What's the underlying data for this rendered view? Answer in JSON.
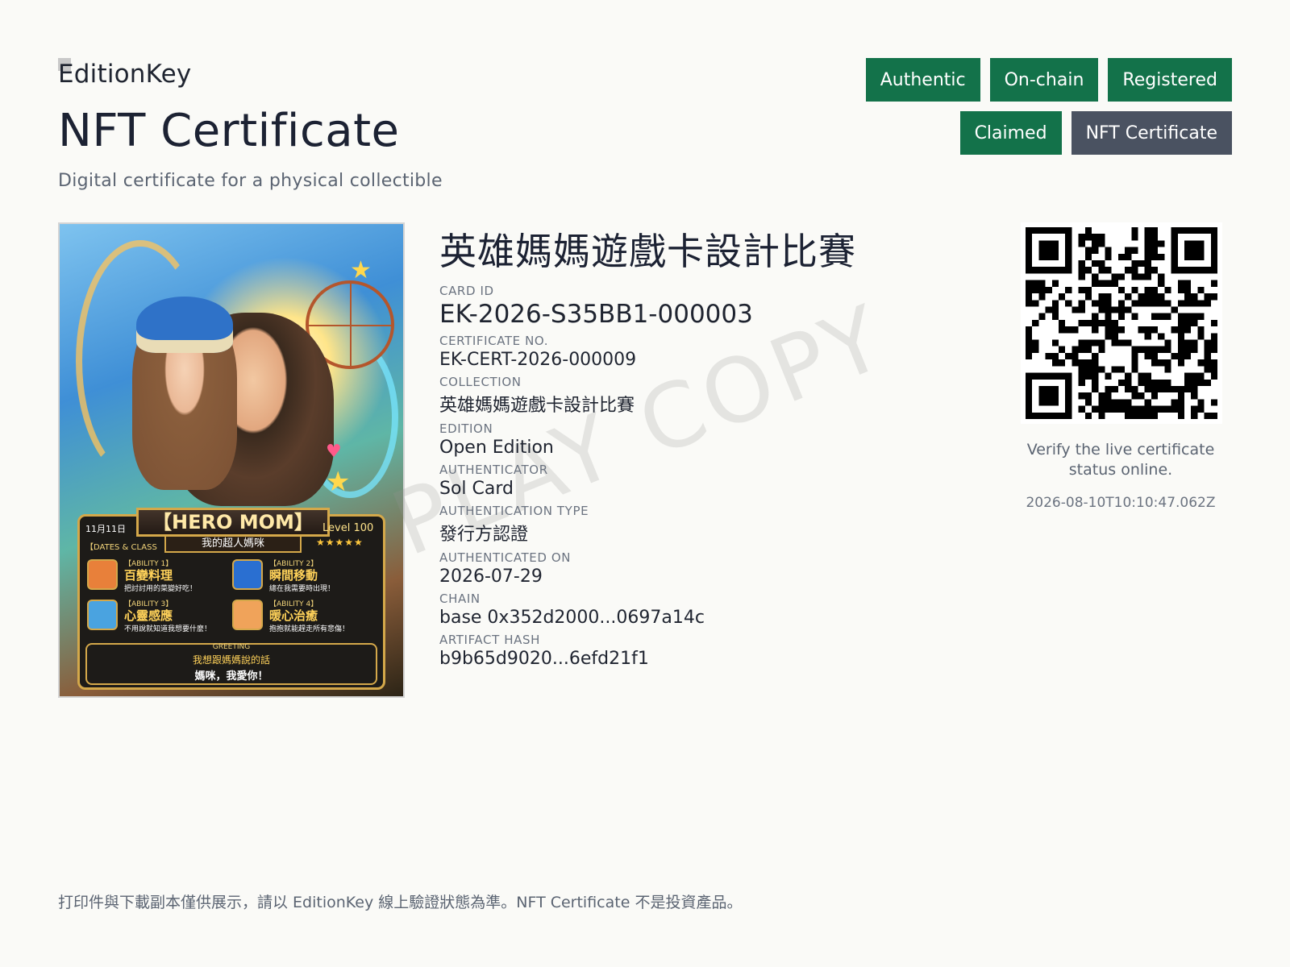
{
  "header": {
    "brand": "EditionKey",
    "title": "NFT Certificate",
    "subtitle": "Digital certificate  for a physical collectible"
  },
  "badges": [
    {
      "label": "Authentic",
      "color": "#13724a"
    },
    {
      "label": "On-chain",
      "color": "#13724a"
    },
    {
      "label": "Registered",
      "color": "#13724a"
    },
    {
      "label": "Claimed",
      "color": "#13724a"
    },
    {
      "label": "NFT Certificate",
      "color": "#4a5261"
    }
  ],
  "card_art": {
    "banner": "【HERO MOM】",
    "subbanner": "我的超人媽咪",
    "date": "11月11日",
    "date_class": "【DATES & CLASS",
    "level": "Level 100",
    "stars": "★★★★★",
    "abilities": [
      {
        "tag": "【ABILITY 1】",
        "name": "百變料理",
        "desc": "把討討用的菜變好吃！"
      },
      {
        "tag": "【ABILITY 2】",
        "name": "瞬間移動",
        "desc": "總在我需要時出現！"
      },
      {
        "tag": "【ABILITY 3】",
        "name": "心靈感應",
        "desc": "不用說就知道我想要什麼！"
      },
      {
        "tag": "【ABILITY 4】",
        "name": "暖心治癒",
        "desc": "抱抱就能趕走所有悲傷！"
      }
    ],
    "greeting_tag": "GREETING",
    "greeting_line1": "我想跟媽媽說的話",
    "greeting_line2": "媽咪，我愛你！"
  },
  "card": {
    "name": "英雄媽媽遊戲卡設計比賽",
    "fields": [
      {
        "label": "CARD ID",
        "value": "EK-2026-S35BB1-000003"
      },
      {
        "label": "CERTIFICATE  NO.",
        "value": "EK-CERT-2026-000009"
      },
      {
        "label": "COLLECTION",
        "value": "英雄媽媽遊戲卡設計比賽"
      },
      {
        "label": "EDITION",
        "value": "Open Edition"
      },
      {
        "label": "AUTHENTICATOR",
        "value": "Sol Card"
      },
      {
        "label": "AUTHENTICATION  TYPE",
        "value": "發行方認證"
      },
      {
        "label": "AUTHENTICATED  ON",
        "value": "2026-07-29"
      },
      {
        "label": "CHAIN",
        "value": "base 0x352d2000...0697a14c"
      },
      {
        "label": "ARTIFACT  HASH",
        "value": "b9b65d9020...6efd21f1"
      }
    ]
  },
  "watermark": "PLAY COPY",
  "qr": {
    "verify_text": "Verify  the live certificate status online.",
    "timestamp": "2026-08-10T10:10:47.062Z"
  },
  "footer": "打印件與下載副本僅供展示，請以 EditionKey  線上驗證狀態為準。NFT Certificate  不是投資產品。"
}
